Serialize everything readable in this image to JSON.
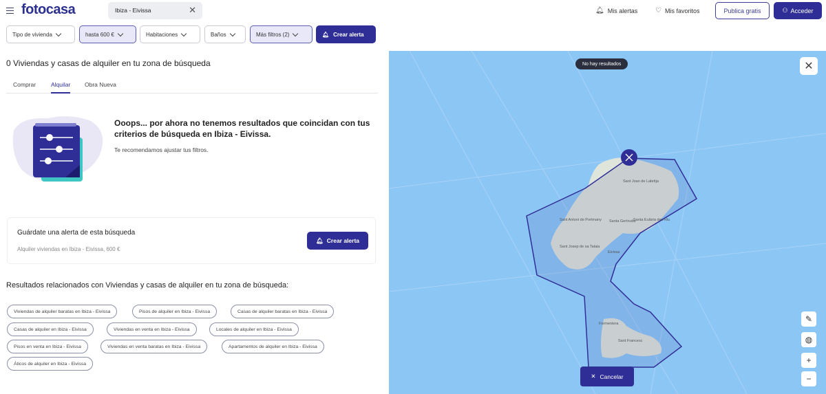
{
  "header": {
    "logo": "fotocasa",
    "search_chip": "Ibiza - Eivissa",
    "alerts_label": "Mis alertas",
    "favorites_label": "Mis favoritos",
    "publish_label": "Publica gratis",
    "login_label": "Acceder"
  },
  "filters": {
    "type": "Tipo de vivienda",
    "price": "hasta 600 €",
    "rooms": "Habitaciones",
    "baths": "Baños",
    "more": "Más filtros (2)",
    "create_alert": "Crear alerta"
  },
  "results": {
    "title": "0  Viviendas y casas de alquiler en tu zona de búsqueda",
    "tabs": [
      "Comprar",
      "Alquilar",
      "Obra Nueva"
    ],
    "empty_title": "Ooops... por ahora no tenemos resultados que coincidan con tus criterios de búsqueda en Ibiza - Eivissa.",
    "empty_sub": "Te recomendamos ajustar tus filtros."
  },
  "alert_card": {
    "title": "Guárdate una alerta de esta búsqueda",
    "subtitle": "Alquiler viviendas en Ibiza - Eivissa, 600 €",
    "button": "Crear alerta"
  },
  "related": {
    "title": "Resultados relacionados con Viviendas y casas de alquiler en tu zona de búsqueda:",
    "chips": [
      "Viviendas de alquiler baratas en Ibiza - Eivissa",
      "Pisos de alquiler en Ibiza - Eivissa",
      "Casas de alquiler baratas en Ibiza - Eivissa",
      "Casas de alquiler en Ibiza - Eivissa",
      "Viviendas en venta en Ibiza - Eivissa",
      "Locales de alquiler en Ibiza - Eivissa",
      "Pisos en venta en Ibiza - Eivissa",
      "Viviendas en venta baratas en Ibiza - Eivissa",
      "Apartamentos de alquiler en Ibiza - Eivissa",
      "Áticos de alquiler en Ibiza - Eivissa"
    ]
  },
  "map": {
    "no_results": "No hay resultados",
    "cancel": "Cancelar",
    "labels": [
      "Sant Joan de Labritja",
      "Sant Antoni de Portmany",
      "Santa Eulària des Riu",
      "Santa Gertrudis",
      "Sant Josep de sa Talaia",
      "Eivissa",
      "Formentera",
      "Sant Francesc"
    ],
    "colors": {
      "water": "#8cc6f5",
      "land": "#dfe5da",
      "polygon": "#2f2e96"
    }
  }
}
